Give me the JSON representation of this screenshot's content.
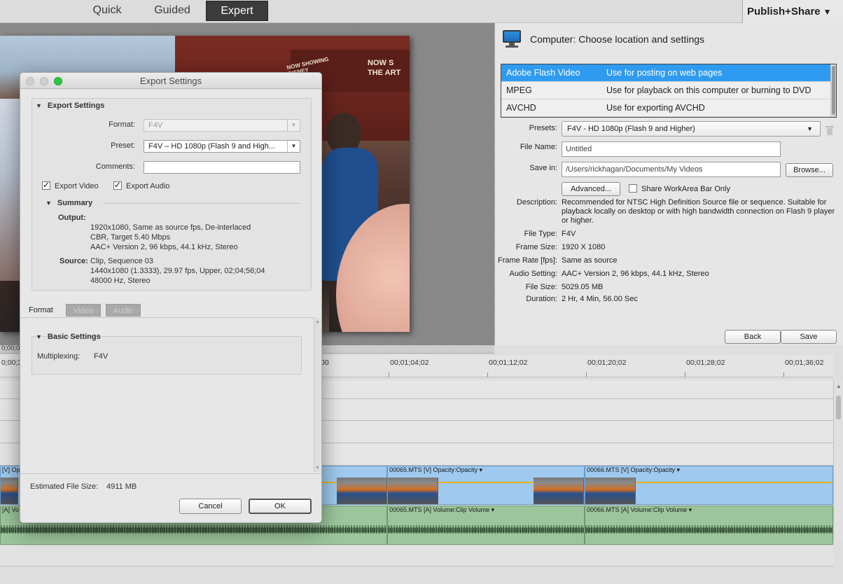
{
  "top_bar": {
    "tabs": [
      {
        "label": "Quick",
        "active": false
      },
      {
        "label": "Guided",
        "active": false
      },
      {
        "label": "Expert",
        "active": true
      }
    ],
    "publish_label": "Publish+Share",
    "publish_chevron": "chevron-down-icon"
  },
  "video": {
    "sign_text": "NOW S\nTHE ART",
    "small_sign": "NOW SHOWING\nDISNEY"
  },
  "publish_panel": {
    "title": "Computer: Choose location and settings",
    "formats": [
      {
        "name": "Adobe Flash Video",
        "desc": "Use for posting on web pages",
        "selected": true
      },
      {
        "name": "MPEG",
        "desc": "Use for playback on this computer or burning to DVD",
        "selected": false
      },
      {
        "name": "AVCHD",
        "desc": "Use for exporting AVCHD",
        "selected": false
      }
    ],
    "presets_label": "Presets:",
    "presets_value": "F4V - HD 1080p  (Flash 9 and Higher)",
    "file_name_label": "File Name:",
    "file_name_value": "Untitled",
    "save_in_label": "Save in:",
    "save_in_value": "/Users/rickhagan/Documents/My Videos",
    "browse_label": "Browse...",
    "advanced_label": "Advanced...",
    "share_workarea_label": "Share WorkArea Bar Only",
    "description_label": "Description:",
    "description_value": "Recommended for NTSC High Definition Source file or sequence. Suitable for playback locally on desktop or with high bandwidth connection on Flash 9 player or higher.",
    "info": [
      {
        "label": "File Type:",
        "value": "F4V"
      },
      {
        "label": "Frame Size:",
        "value": "1920 X 1080"
      },
      {
        "label": "Frame Rate [fps]:",
        "value": "Same as source"
      },
      {
        "label": "Audio Setting:",
        "value": "AAC+ Version 2, 96 kbps, 44.1 kHz, Stereo"
      },
      {
        "label": "File Size:",
        "value": "5029.05 MB"
      },
      {
        "label": "Duration:",
        "value": "2 Hr, 4 Min, 56.00 Sec"
      }
    ],
    "back_label": "Back",
    "save_label": "Save"
  },
  "timeline": {
    "top_tc": "0;00;00",
    "timecodes": [
      "0;00;3",
      "00",
      "00;01;04;02",
      "00;01;12;02",
      "00;01;20;02",
      "00;01;28;02",
      "00;01;36;02"
    ],
    "video_clips": [
      {
        "label": "[V] Op"
      },
      {
        "label": "00065.MTS [V]  Opacity:Opacity ▾"
      },
      {
        "label": "00066.MTS [V]  Opacity:Opacity ▾"
      }
    ],
    "audio_clips": [
      {
        "label": "[A] Vo"
      },
      {
        "label": "00065.MTS [A]  Volume:Clip Volume ▾"
      },
      {
        "label": "00066.MTS [A]  Volume:Clip Volume ▾"
      }
    ]
  },
  "dialog": {
    "title": "Export Settings",
    "export_settings_header": "Export Settings",
    "format_label": "Format:",
    "format_value": "F4V",
    "preset_label": "Preset:",
    "preset_value": "F4V – HD 1080p  (Flash 9 and High...",
    "comments_label": "Comments:",
    "comments_value": "",
    "export_video_label": "Export Video",
    "export_audio_label": "Export Audio",
    "summary_header": "Summary",
    "output_label": "Output:",
    "output_lines": [
      "1920x1080, Same as source fps, De-interlaced",
      "CBR, Target 5.40 Mbps",
      "AAC+ Version 2, 96 kbps, 44.1 kHz, Stereo"
    ],
    "source_label": "Source:",
    "source_lines": [
      "Clip, Sequence 03",
      "1440x1080 (1.3333), 29.97 fps, Upper, 02;04;56;04",
      "48000 Hz, Stereo"
    ],
    "tabs": [
      {
        "label": "Format",
        "active": true
      },
      {
        "label": "Video",
        "active": false
      },
      {
        "label": "Audio",
        "active": false
      }
    ],
    "basic_settings_header": "Basic Settings",
    "multiplexing_label": "Multiplexing:",
    "multiplexing_value": "F4V",
    "estimated_label": "Estimated File Size:",
    "estimated_value": "4911 MB",
    "cancel_label": "Cancel",
    "ok_label": "OK"
  }
}
